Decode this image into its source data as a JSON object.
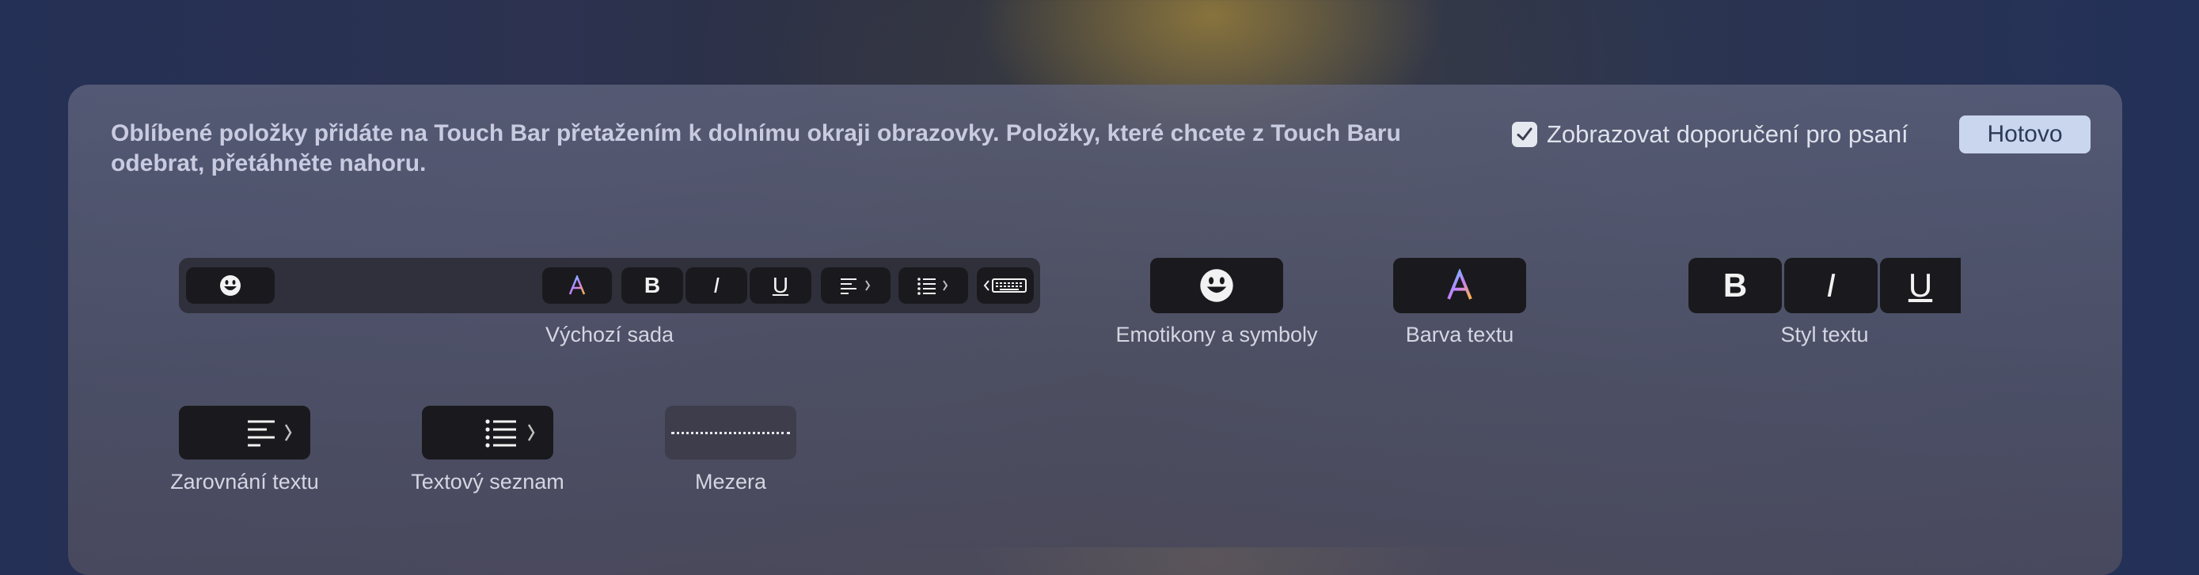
{
  "header": {
    "instructions": "Oblíbené položky přidáte na Touch Bar přetažením k dolnímu okraji obrazovky. Položky, které chcete z Touch Baru odebrat, přetáhněte nahoru.",
    "suggestions_checkbox": {
      "label": "Zobrazovat doporučení pro psaní",
      "checked": true
    },
    "done_button": "Hotovo"
  },
  "items": {
    "default_set": {
      "label": "Výchozí sada",
      "buttons": {
        "bold": "B",
        "italic": "I",
        "underline": "U",
        "color": "A"
      }
    },
    "emoji": {
      "label": "Emotikony a symboly"
    },
    "text_color": {
      "label": "Barva textu",
      "glyph": "A"
    },
    "text_style": {
      "label": "Styl textu",
      "bold": "B",
      "italic": "I",
      "underline": "U"
    },
    "text_alignment": {
      "label": "Zarovnání textu"
    },
    "text_list": {
      "label": "Textový seznam"
    },
    "space": {
      "label": "Mezera"
    }
  },
  "colors": {
    "key_bg": "#1a1a1e",
    "done_button_bg": "#c9d6ee",
    "panel": "#5c6078"
  }
}
